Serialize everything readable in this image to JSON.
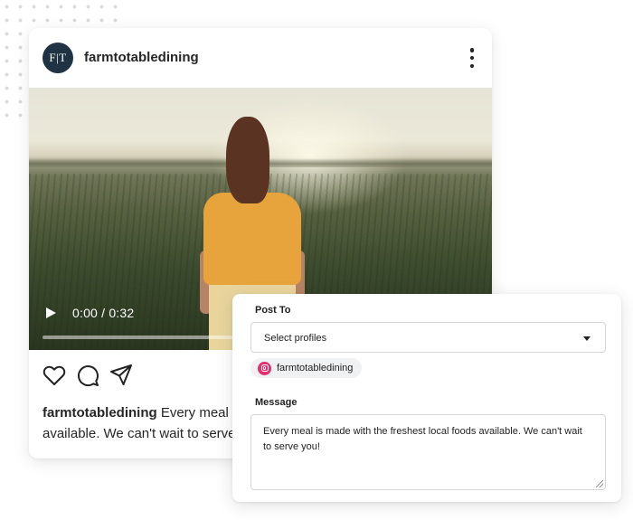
{
  "post": {
    "avatar_text": "F|T",
    "username": "farmtotabledining",
    "more_icon": "more-vertical-icon",
    "video": {
      "time": "0:00 / 0:32",
      "progress": 0
    },
    "actions": [
      "heart-icon",
      "comment-icon",
      "share-icon"
    ],
    "caption": {
      "username": "farmtotabledining",
      "text": " Every meal is made with the freshest local foods available. We can't wait to serve you!"
    }
  },
  "composer": {
    "post_to_label": "Post To",
    "select_value": "Select profiles",
    "profiles": [
      {
        "network": "instagram",
        "name": "farmtotabledining",
        "color": "#e1306c"
      }
    ],
    "message_label": "Message",
    "message_text": "Every meal is made with the freshest local foods available. We can't wait to serve you!"
  }
}
